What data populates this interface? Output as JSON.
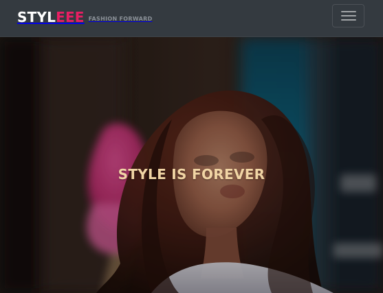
{
  "brand": {
    "main_part1": "STYL",
    "main_part2": "EEE",
    "tagline": "FASHION FORWARD",
    "colors": {
      "primary": "#ffffff",
      "accent": "#e91e63",
      "tagline": "#8b9198"
    }
  },
  "navbar": {
    "menu_icon": "hamburger-icon",
    "bg": "#343a40"
  },
  "hero": {
    "heading": "STYLE IS FOREVER",
    "heading_color": "#f1d5a5",
    "image_label": "hero-photo"
  }
}
